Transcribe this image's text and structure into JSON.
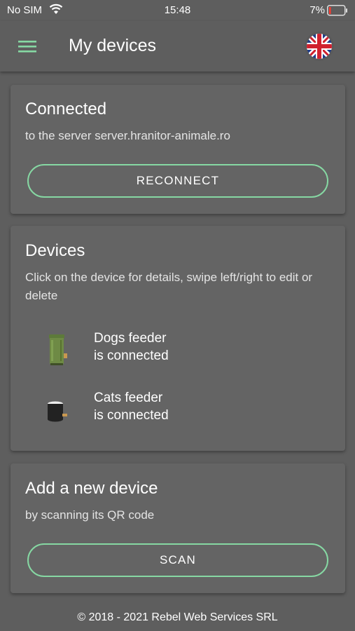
{
  "status_bar": {
    "carrier": "No SIM",
    "time": "15:48",
    "battery": "7%"
  },
  "app_bar": {
    "title": "My devices",
    "menu_icon": "hamburger-menu-icon",
    "language_icon": "uk-flag-icon"
  },
  "connection": {
    "title": "Connected",
    "subtitle": "to the server server.hranitor-animale.ro",
    "button_label": "RECONNECT"
  },
  "devices": {
    "title": "Devices",
    "subtitle": "Click on the device for details, swipe left/right to edit or delete",
    "items": [
      {
        "name": "Dogs feeder",
        "status": "is connected",
        "icon": "green-feeder-icon"
      },
      {
        "name": "Cats feeder",
        "status": "is connected",
        "icon": "black-feeder-icon"
      }
    ]
  },
  "add_device": {
    "title": "Add a new device",
    "subtitle": "by scanning its QR code",
    "button_label": "SCAN"
  },
  "footer": "© 2018 - 2021 Rebel Web Services SRL",
  "colors": {
    "background": "#5e5e5e",
    "card": "#646464",
    "accent": "#86d8a3"
  }
}
